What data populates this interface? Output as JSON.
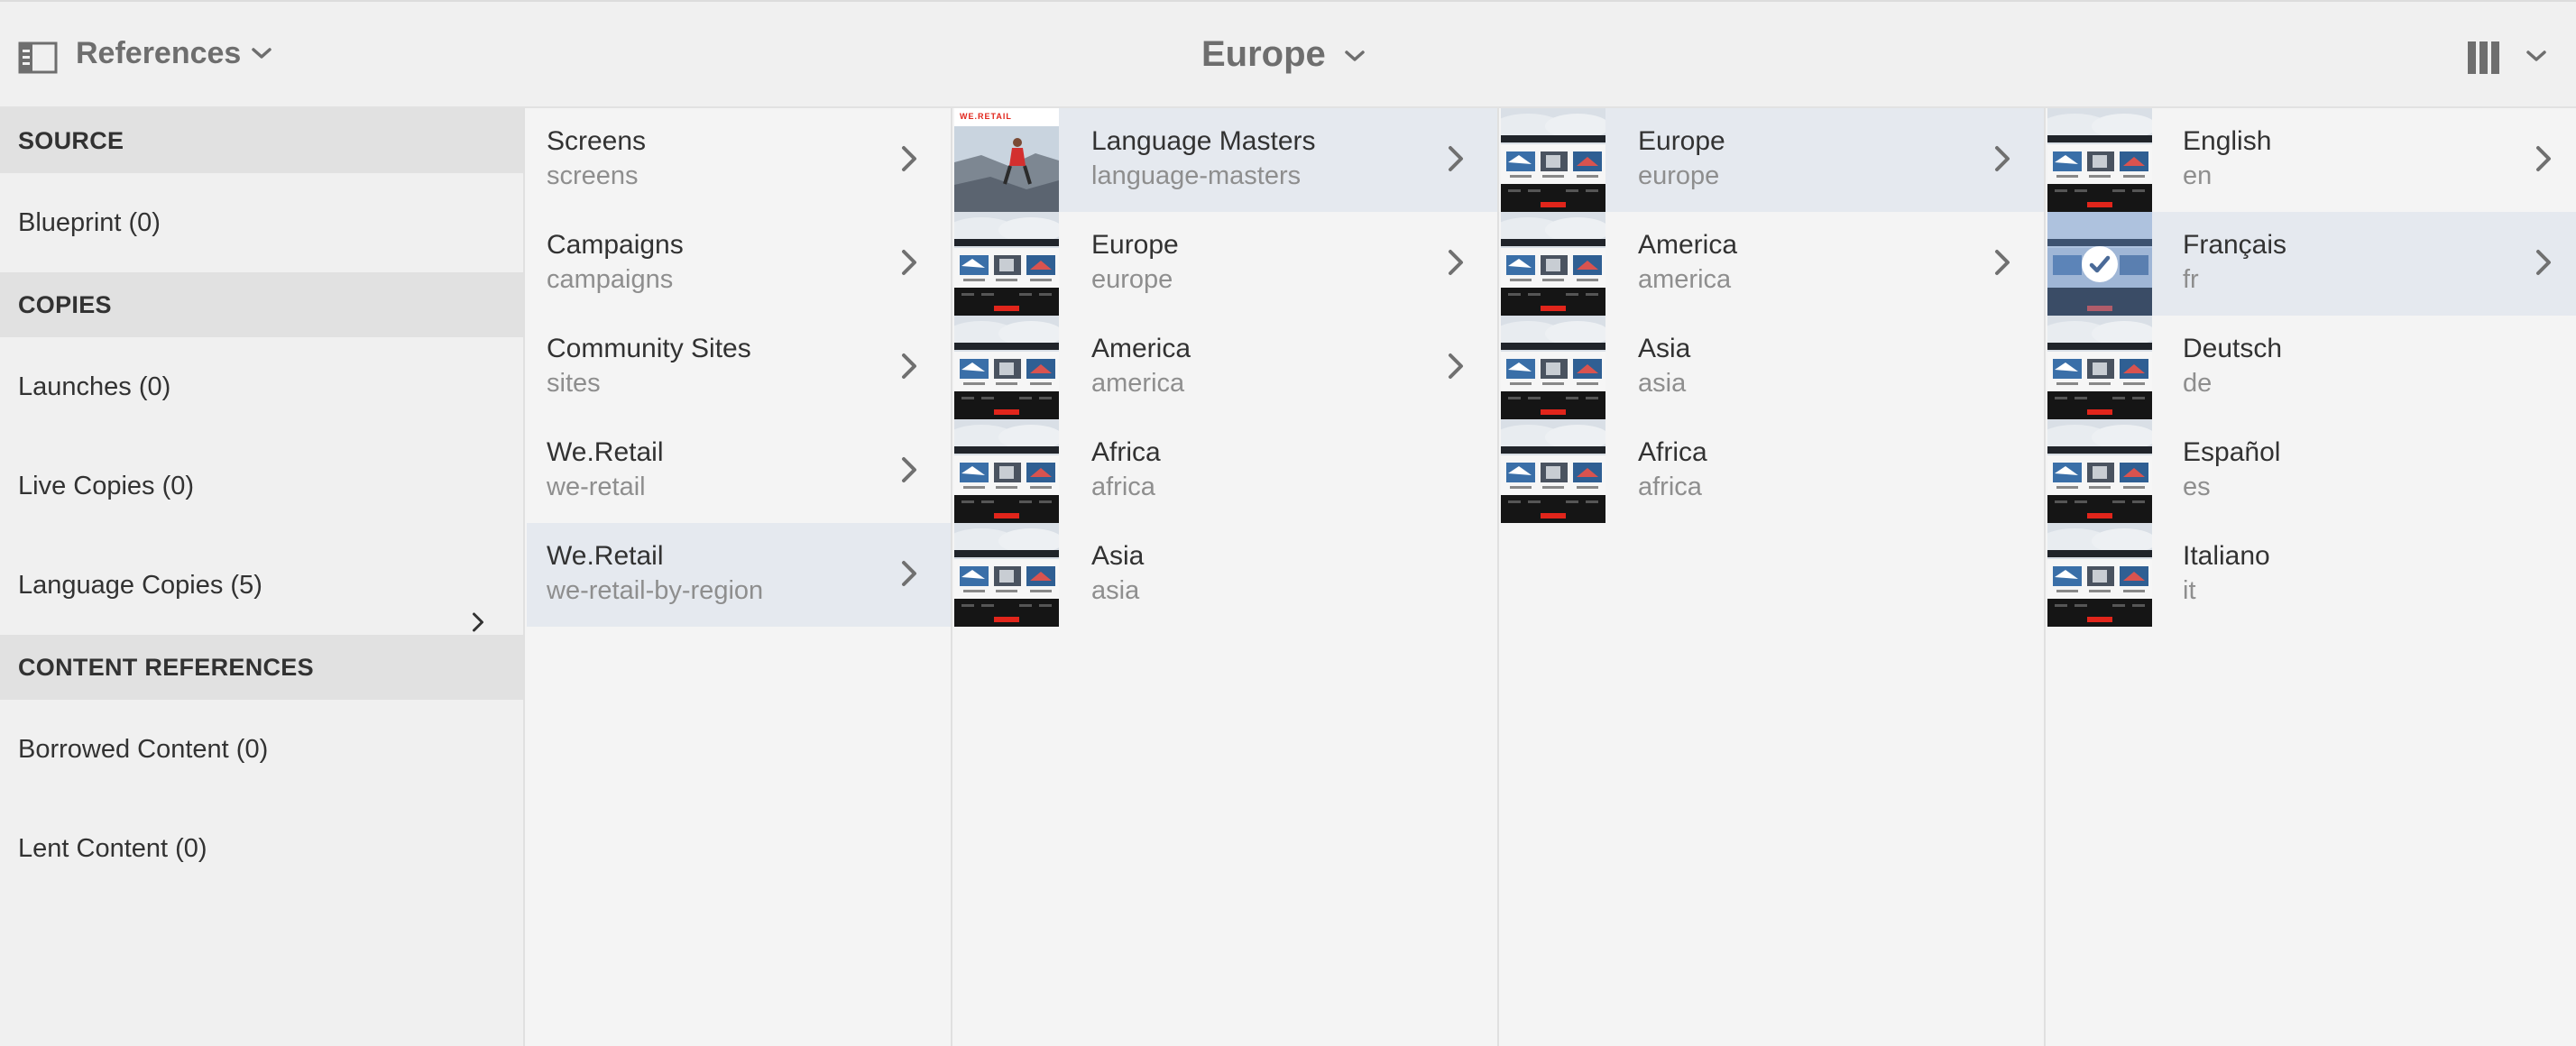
{
  "topbar": {
    "rail_label": "References",
    "title": "Europe"
  },
  "rail": {
    "sections": [
      {
        "heading": "SOURCE",
        "items": [
          {
            "label": "Blueprint (0)"
          }
        ]
      },
      {
        "heading": "COPIES",
        "items": [
          {
            "label": "Launches (0)"
          },
          {
            "label": "Live Copies (0)"
          },
          {
            "label": "Language Copies (5)"
          }
        ]
      },
      {
        "heading": "CONTENT REFERENCES",
        "items": [
          {
            "label": "Borrowed Content (0)"
          },
          {
            "label": "Lent Content (0)"
          }
        ]
      }
    ]
  },
  "columns": [
    {
      "items": [
        {
          "title": "Screens",
          "name": "screens"
        },
        {
          "title": "Campaigns",
          "name": "campaigns"
        },
        {
          "title": "Community Sites",
          "name": "sites"
        },
        {
          "title": "We.Retail",
          "name": "we-retail"
        },
        {
          "title": "We.Retail",
          "name": "we-retail-by-region"
        }
      ]
    },
    {
      "items": [
        {
          "title": "Language Masters",
          "name": "language-masters"
        },
        {
          "title": "Europe",
          "name": "europe"
        },
        {
          "title": "America",
          "name": "america"
        },
        {
          "title": "Africa",
          "name": "africa"
        },
        {
          "title": "Asia",
          "name": "asia"
        }
      ]
    },
    {
      "items": [
        {
          "title": "Europe",
          "name": "europe"
        },
        {
          "title": "America",
          "name": "america"
        },
        {
          "title": "Asia",
          "name": "asia"
        },
        {
          "title": "Africa",
          "name": "africa"
        }
      ]
    },
    {
      "items": [
        {
          "title": "English",
          "name": "en"
        },
        {
          "title": "Français",
          "name": "fr"
        },
        {
          "title": "Deutsch",
          "name": "de"
        },
        {
          "title": "Español",
          "name": "es"
        },
        {
          "title": "Italiano",
          "name": "it"
        }
      ]
    }
  ],
  "thumb_logo": "WE.RETAIL",
  "colors": {
    "accent_red": "#e1251b",
    "selected_row": "#e5e9ef",
    "hero_sky": "#c9d4df"
  }
}
